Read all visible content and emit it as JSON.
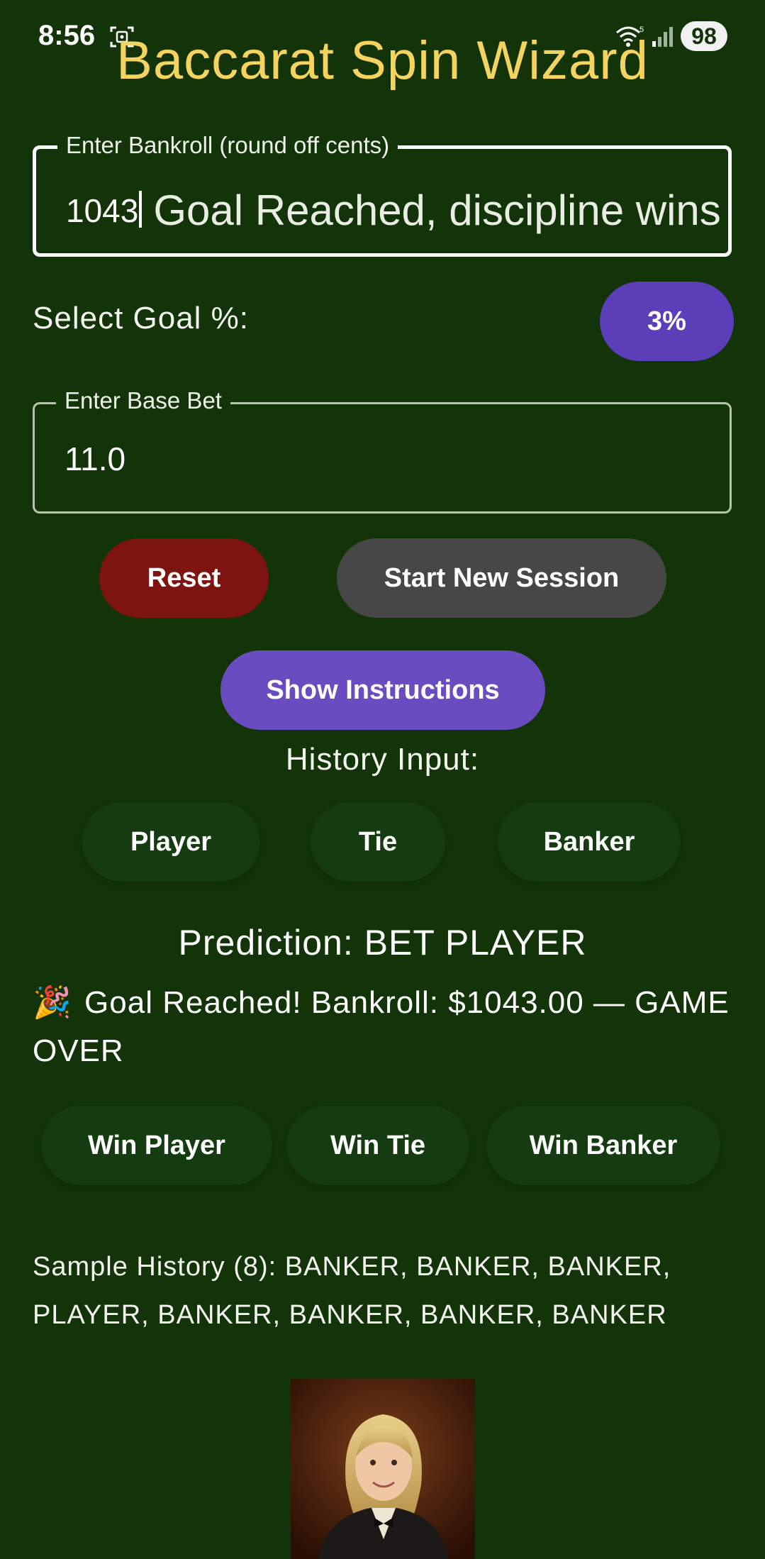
{
  "status_bar": {
    "time": "8:56",
    "battery": "98",
    "icons": [
      "screenshot-icon",
      "wifi-icon",
      "signal-icon"
    ]
  },
  "app": {
    "title": "Baccarat Spin Wizard",
    "title_color": "#f4d35e",
    "background_color": "#133409"
  },
  "bankroll_field": {
    "label": "Enter Bankroll (round off cents)",
    "value": "1043",
    "overlay_text": "Goal Reached, discipline wins"
  },
  "goal": {
    "label": "Select Goal %:",
    "value": "3%"
  },
  "base_bet_field": {
    "label": "Enter Base Bet",
    "value": "11.0"
  },
  "actions": {
    "reset": "Reset",
    "start_new_session": "Start New Session",
    "show_instructions": "Show Instructions"
  },
  "history_input": {
    "label": "History Input:",
    "buttons": [
      "Player",
      "Tie",
      "Banker"
    ]
  },
  "prediction": "Prediction: BET PLAYER",
  "goal_message": {
    "emoji": "🎉",
    "text": "Goal Reached! Bankroll: $1043.00 — GAME OVER"
  },
  "win_buttons": [
    "Win Player",
    "Win Tie",
    "Win Banker"
  ],
  "sample_history": "Sample History (8): BANKER, BANKER, BANKER, PLAYER, BANKER, BANKER, BANKER, BANKER",
  "colors": {
    "goal_button": "#5c3fb8",
    "reset_button": "#7d1410",
    "session_button": "#474747",
    "instructions_button": "#6a4bc0"
  }
}
